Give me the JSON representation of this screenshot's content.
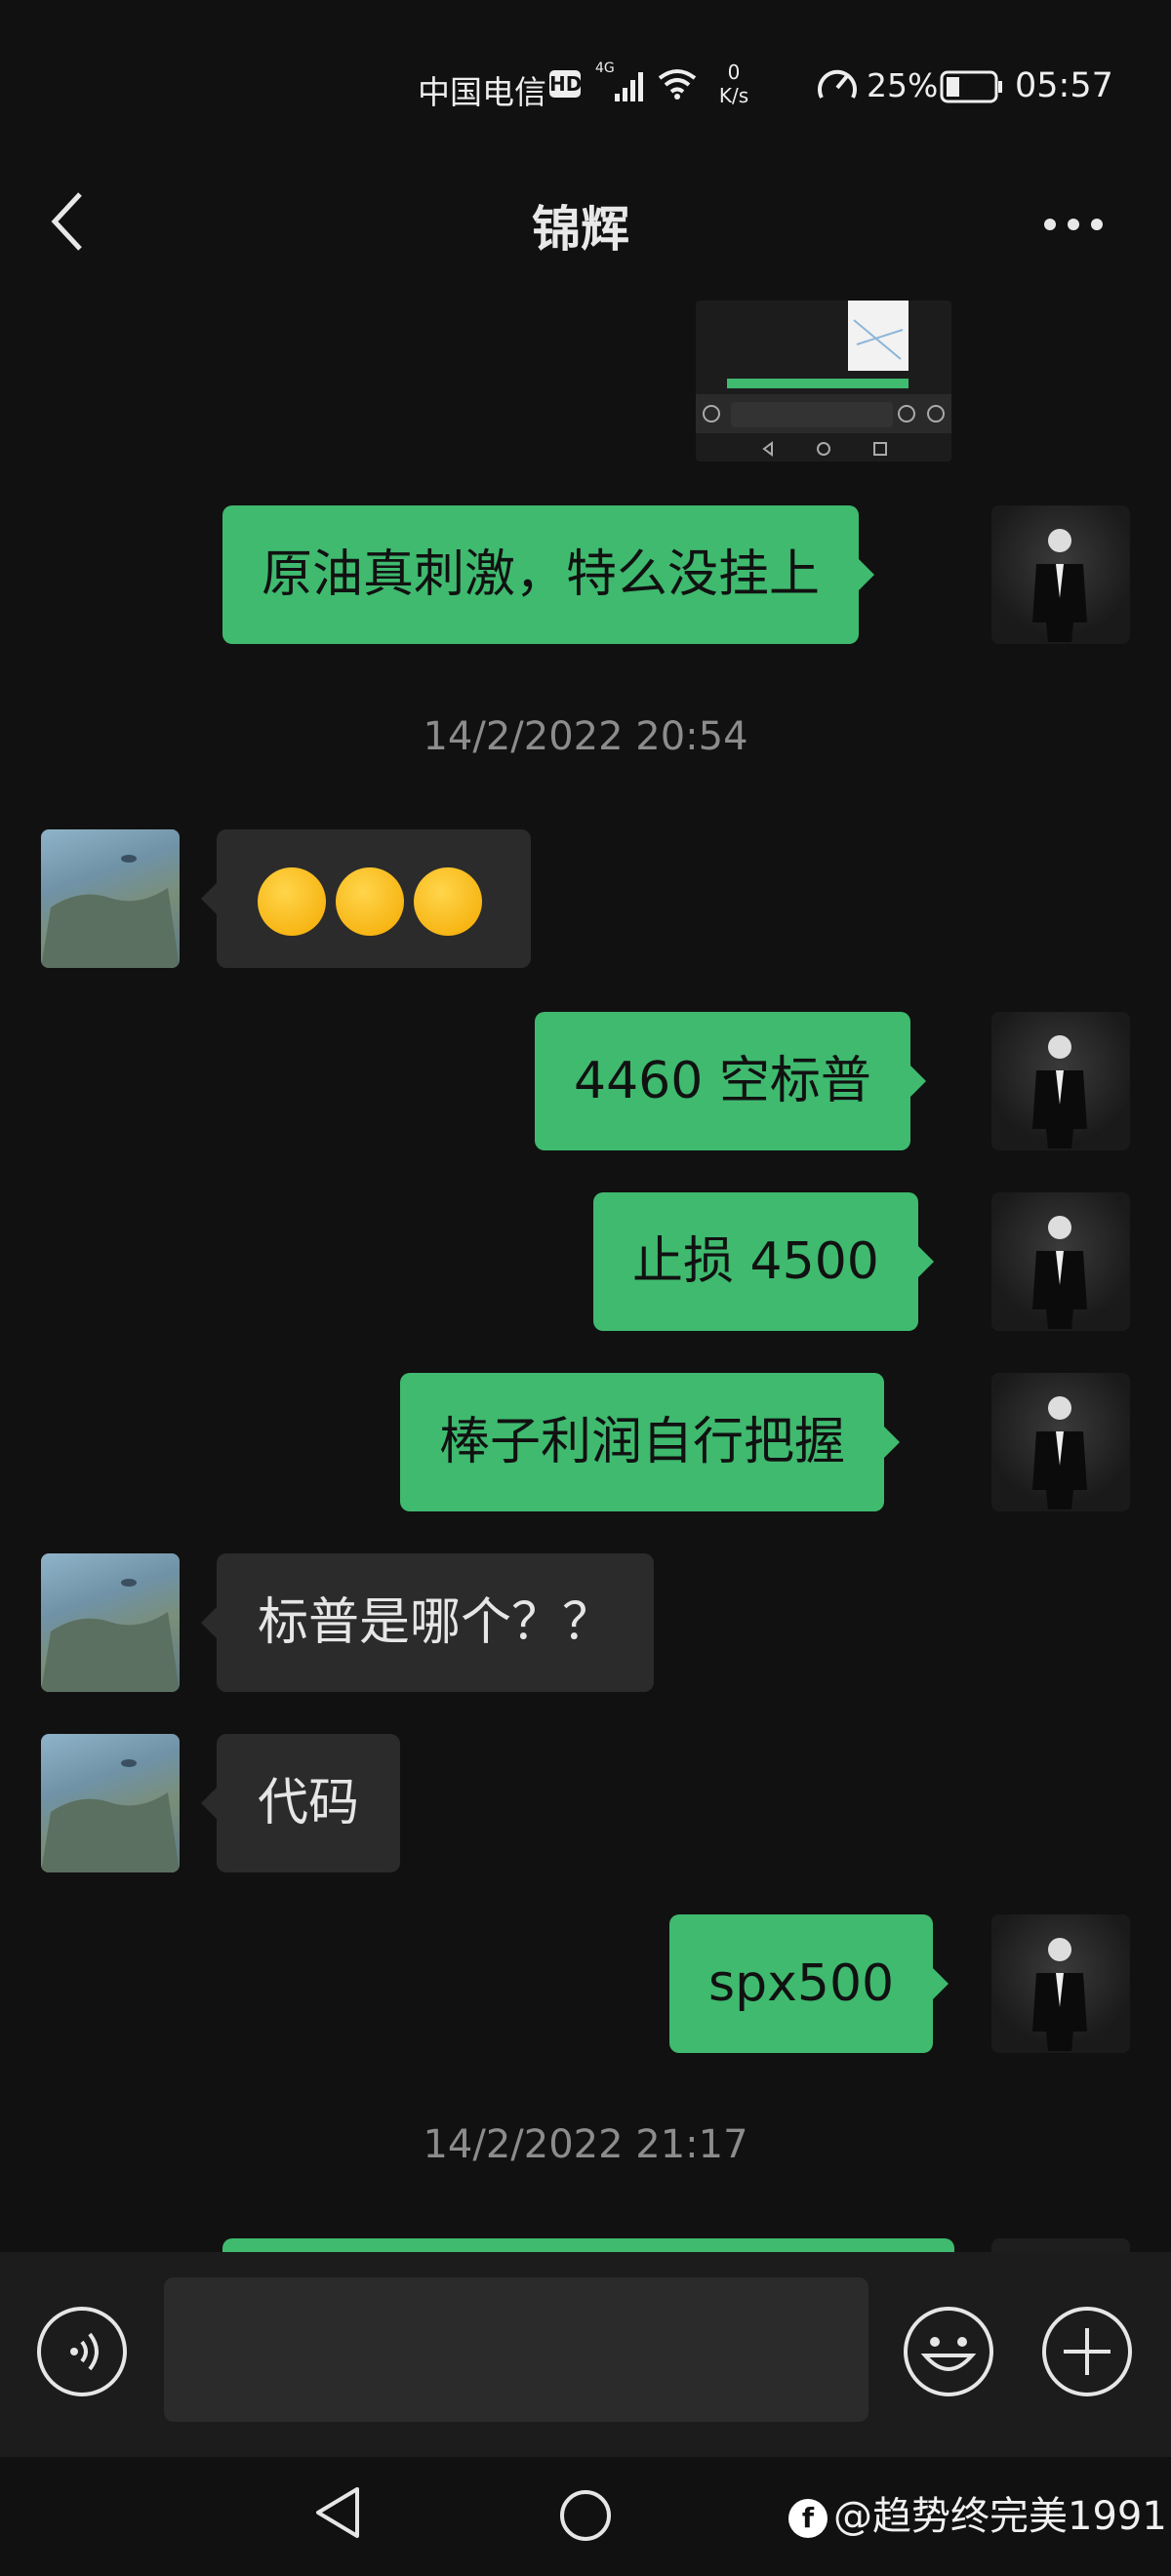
{
  "status_bar": {
    "carrier": "中国电信",
    "hd": "HD",
    "net_speed_value": "0",
    "net_speed_unit": "K/s",
    "battery": "25%",
    "time": "05:57"
  },
  "header": {
    "title": "锦辉"
  },
  "timestamps": [
    "14/2/2022 20:54",
    "14/2/2022 21:17"
  ],
  "messages": [
    {
      "from": "me",
      "text": "原油真刺激，特么没挂上"
    },
    {
      "from": "them",
      "emoji": [
        "loudly-crying-face",
        "loudly-crying-face",
        "loudly-crying-face"
      ]
    },
    {
      "from": "me",
      "text": "4460 空标普"
    },
    {
      "from": "me",
      "text": "止损 4500"
    },
    {
      "from": "me",
      "text": "棒子利润自行把握"
    },
    {
      "from": "them",
      "text": "标普是哪个？？"
    },
    {
      "from": "them",
      "text": "代码"
    },
    {
      "from": "me",
      "text": "spx500"
    }
  ],
  "watermark": {
    "logo": "f",
    "text": "@趋势终完美1991"
  },
  "colors": {
    "background": "#111111",
    "out_bubble": "#3fba6f",
    "in_bubble": "#2b2b2b",
    "timestamp": "#8c8c8c"
  }
}
